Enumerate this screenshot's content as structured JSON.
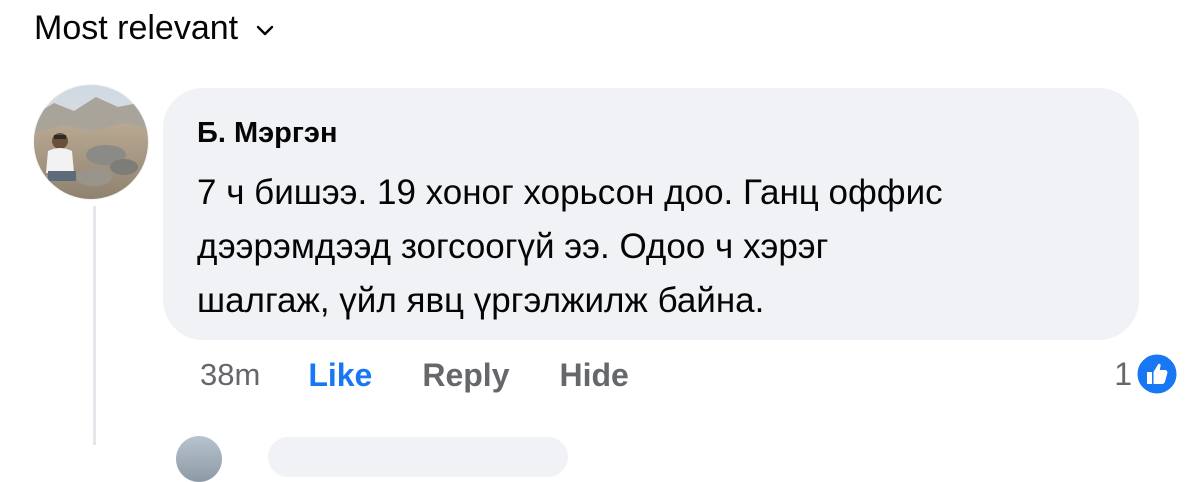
{
  "sort": {
    "label": "Most relevant",
    "icon": "chevron-down-icon"
  },
  "comment": {
    "author": "Б. Мэргэн",
    "text_lines": [
      "7 ч бишээ. 19 хоног хорьсон доо. Ганц оффис",
      "дээрэмдээд зогсоогүй ээ. Одоо ч хэрэг",
      "шалгаж, үйл явц үргэлжилж байна."
    ],
    "timestamp": "38m",
    "actions": {
      "like": "Like",
      "reply": "Reply",
      "hide": "Hide"
    },
    "reaction_count": "1",
    "reaction_icon": "like-reaction-icon"
  },
  "colors": {
    "bubble_bg": "#f0f2f5",
    "like_blue": "#1877f2",
    "secondary_text": "#65676b",
    "primary_text": "#050505"
  }
}
